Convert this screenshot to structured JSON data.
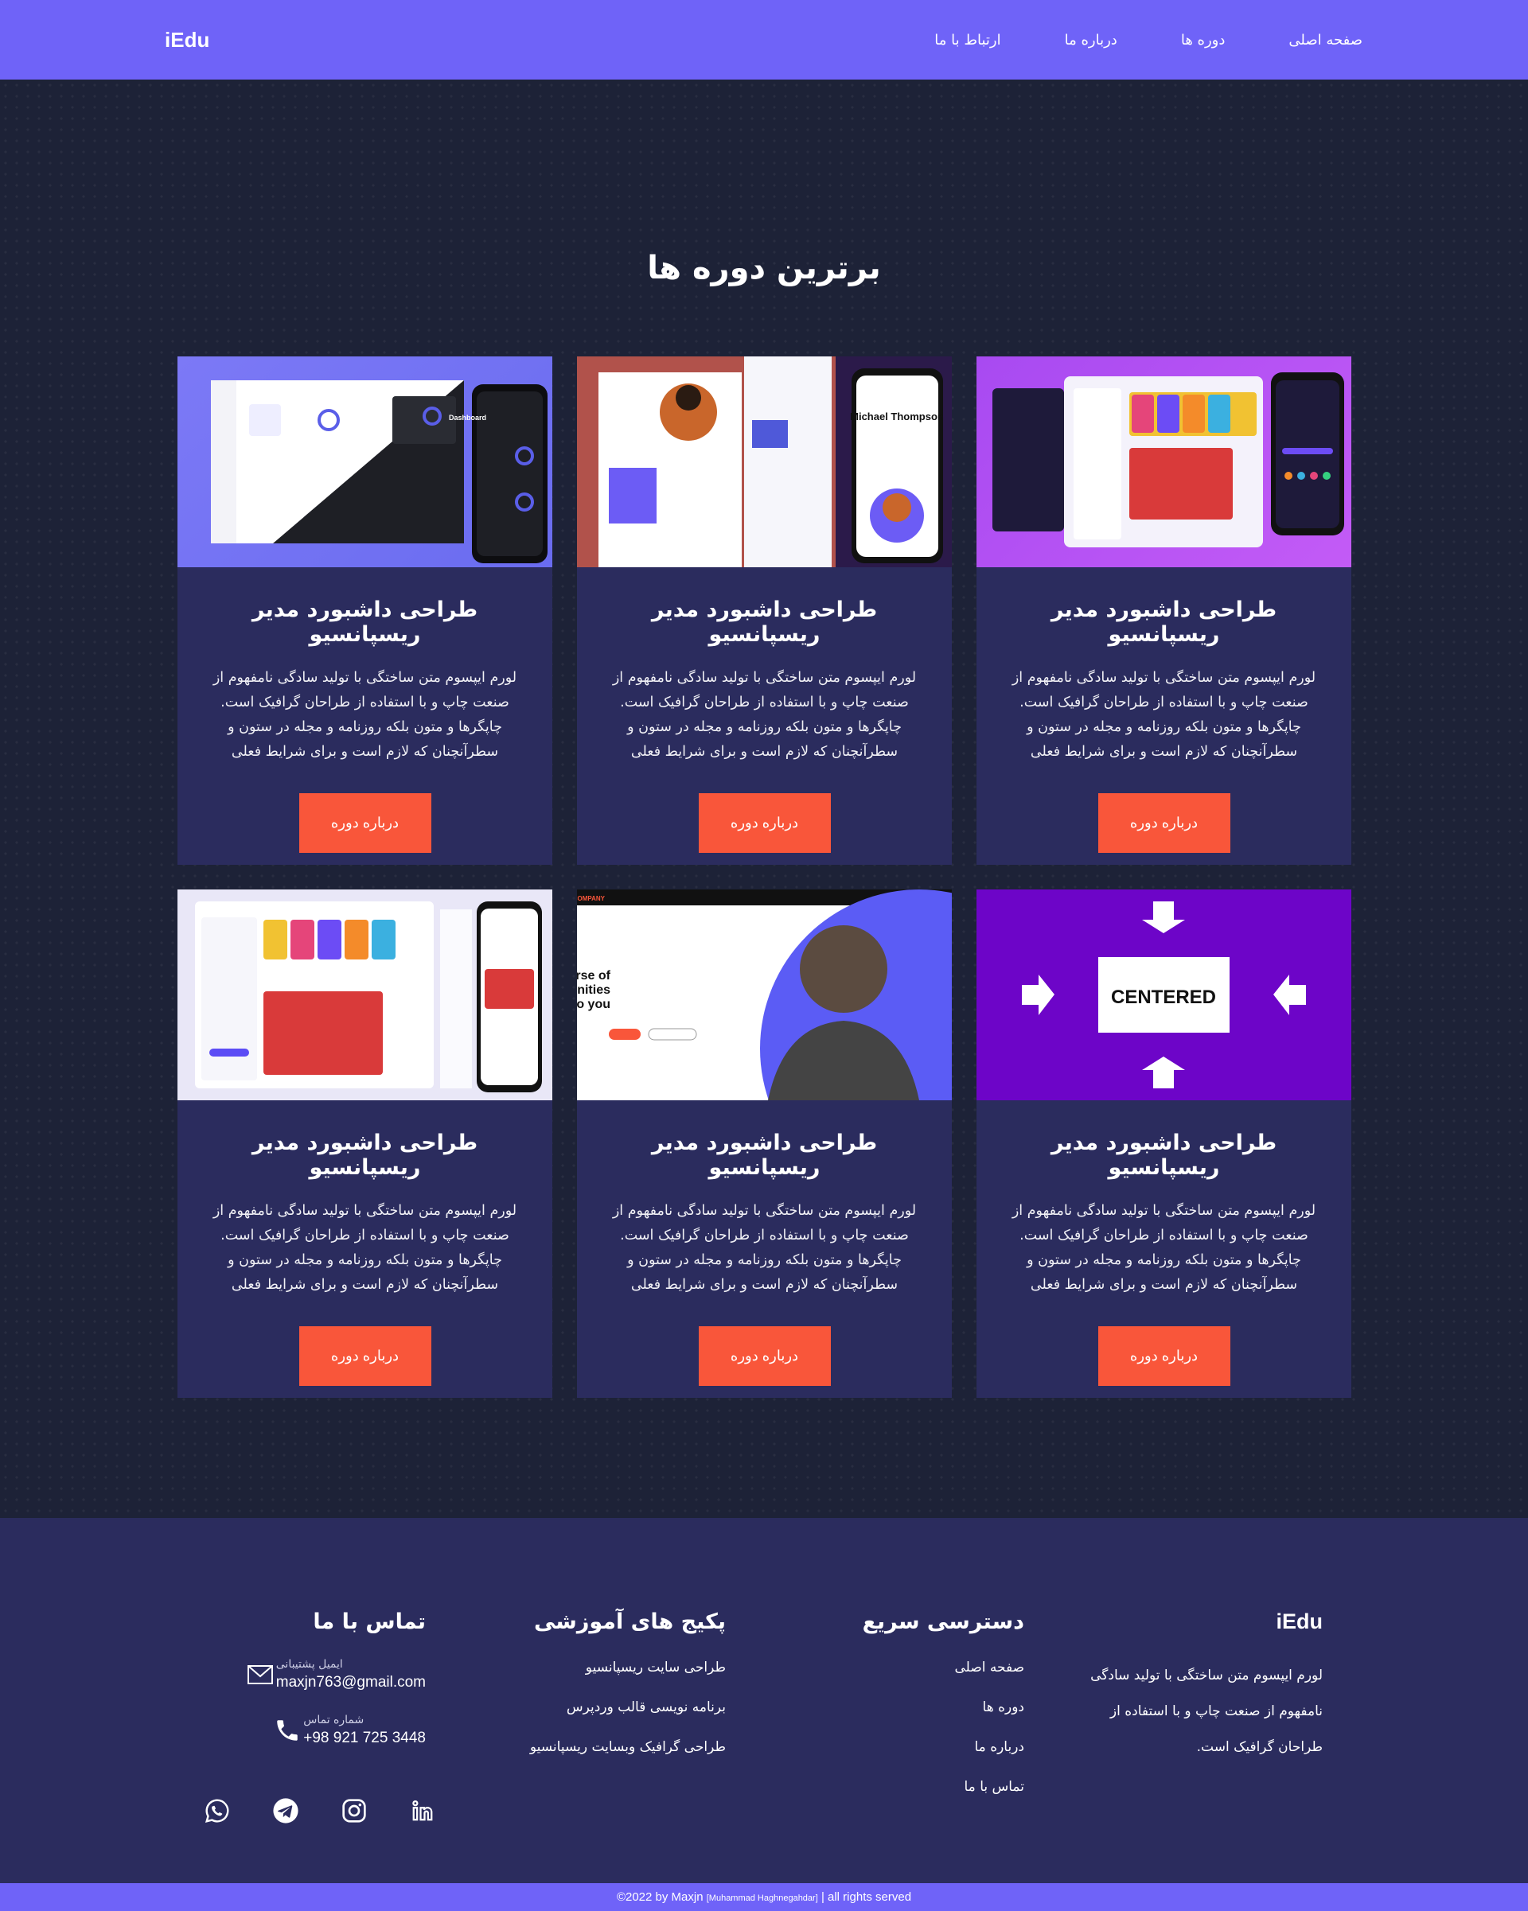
{
  "nav": {
    "links": [
      "صفحه اصلی",
      "دوره ها",
      "درباره ما",
      "ارتباط با ما"
    ],
    "logo": "iEdu"
  },
  "main": {
    "title": "برترین دوره ها",
    "cards": [
      {
        "title": "طراحی داشبورد مدیر ریسپانسیو",
        "desc": "لورم ایپسوم متن ساختگی با تولید سادگی نامفهوم از صنعت چاپ و با استفاده از طراحان گرافیک است. چاپگرها و متون بلکه روزنامه و مجله در ستون و سطرآنچنان که لازم است و برای شرایط فعلی",
        "button": "درباره دوره",
        "thumb": "dashboard-preview"
      },
      {
        "title": "طراحی داشبورد مدیر ریسپانسیو",
        "desc": "لورم ایپسوم متن ساختگی با تولید سادگی نامفهوم از صنعت چاپ و با استفاده از طراحان گرافیک است. چاپگرها و متون بلکه روزنامه و مجله در ستون و سطرآنچنان که لازم است و برای شرایط فعلی",
        "button": "درباره دوره",
        "thumb": "portfolio-preview"
      },
      {
        "title": "طراحی داشبورد مدیر ریسپانسیو",
        "desc": "لورم ایپسوم متن ساختگی با تولید سادگی نامفهوم از صنعت چاپ و با استفاده از طراحان گرافیک است. چاپگرها و متون بلکه روزنامه و مجله در ستون و سطرآنچنان که لازم است و برای شرایط فعلی",
        "button": "درباره دوره",
        "thumb": "social-dark-preview"
      },
      {
        "title": "طراحی داشبورد مدیر ریسپانسیو",
        "desc": "لورم ایپسوم متن ساختگی با تولید سادگی نامفهوم از صنعت چاپ و با استفاده از طراحان گرافیک است. چاپگرها و متون بلکه روزنامه و مجله در ستون و سطرآنچنان که لازم است و برای شرایط فعلی",
        "button": "درباره دوره",
        "thumb": "social-light-preview"
      },
      {
        "title": "طراحی داشبورد مدیر ریسپانسیو",
        "desc": "لورم ایپسوم متن ساختگی با تولید سادگی نامفهوم از صنعت چاپ و با استفاده از طراحان گرافیک است. چاپگرها و متون بلکه روزنامه و مجله در ستون و سطرآنچنان که لازم است و برای شرایط فعلی",
        "button": "درباره دوره",
        "thumb": "landing-preview"
      },
      {
        "title": "طراحی داشبورد مدیر ریسپانسیو",
        "desc": "لورم ایپسوم متن ساختگی با تولید سادگی نامفهوم از صنعت چاپ و با استفاده از طراحان گرافیک است. چاپگرها و متون بلکه روزنامه و مجله در ستون و سطرآنچنان که لازم است و برای شرایط فعلی",
        "button": "درباره دوره",
        "thumb": "centered-preview"
      }
    ],
    "thumb_text": {
      "dashboard": "Dashboard",
      "portfolio_name": "Michael Thompson",
      "landing_headline": "A universe of opportunities Open to you.",
      "landing_company": "COMPANY",
      "centered": "CENTERED"
    }
  },
  "footer": {
    "about": {
      "title": "iEdu",
      "text": "لورم ایپسوم متن ساختگی با تولید سادگی نامفهوم از صنعت چاپ و با استفاده از طراحان گرافیک است."
    },
    "quick": {
      "title": "دسترسی سریع",
      "items": [
        "صفحه اصلی",
        "دوره ها",
        "درباره ما",
        "تماس با ما"
      ]
    },
    "packages": {
      "title": "پکیج های آموزشی",
      "items": [
        "طراحی سایت ریسپانسیو",
        "برنامه نویسی قالب وردپرس",
        "طراحی گرافیک وبسایت ریسپانسیو"
      ]
    },
    "contact": {
      "title": "تماس با ما",
      "email_label": "ایمیل پشتیبانی",
      "email": "maxjn763@gmail.com",
      "phone_label": "شماره تماس",
      "phone": "+98 921 725 3448"
    },
    "socials": [
      "whatsapp-icon",
      "telegram-icon",
      "instagram-icon",
      "linkedin-icon"
    ]
  },
  "copyright": {
    "prefix": "©2022 by Maxjn",
    "name": "[Muhammad Haghnegahdar]",
    "suffix": "| all rights served"
  },
  "colors": {
    "nav": "#6f63f8",
    "bg": "#1d2237",
    "card": "#2b2c5e",
    "button": "#f9563a"
  }
}
